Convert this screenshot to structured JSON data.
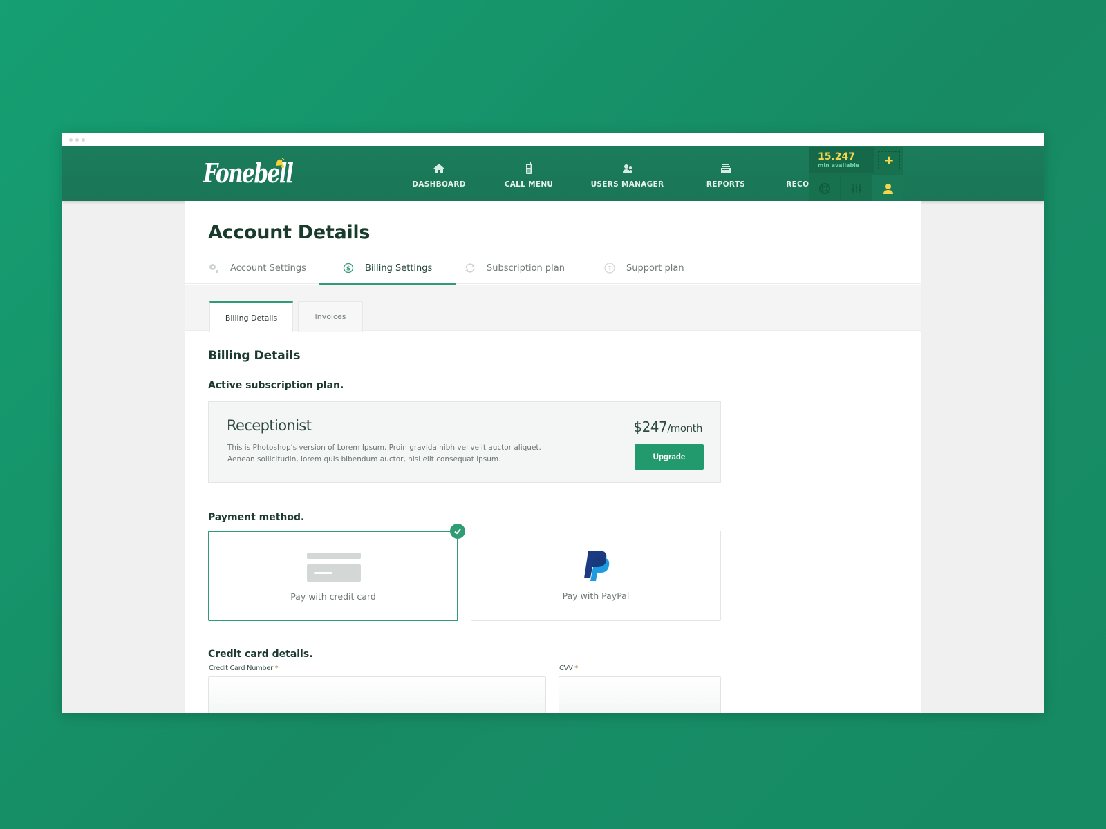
{
  "app": {
    "logo_text": "Fonebell",
    "colors": {
      "brand_green": "#1b7c5b",
      "accent_green": "#2f9c74",
      "button_green": "#239a6e",
      "minutes_yellow": "#f5d64a",
      "paypal_dark": "#1b3a82",
      "paypal_light": "#1e9ae0"
    }
  },
  "nav": {
    "items": [
      {
        "label": "DASHBOARD",
        "icon": "home-icon"
      },
      {
        "label": "CALL MENU",
        "icon": "mobile-phone-icon"
      },
      {
        "label": "USERS MANAGER",
        "icon": "users-icon"
      },
      {
        "label": "REPORTS",
        "icon": "reports-icon"
      },
      {
        "label": "RECORDINGS",
        "icon": "microphone-icon"
      }
    ],
    "minutes": {
      "value": "15.247",
      "caption": "min available",
      "add_label": "+"
    },
    "tools": [
      {
        "icon": "lifebuoy-icon"
      },
      {
        "icon": "sliders-icon"
      },
      {
        "icon": "user-icon"
      }
    ]
  },
  "page": {
    "title": "Account Details",
    "tabs": [
      {
        "label": "Account Settings",
        "icon": "gear-icon",
        "active": false
      },
      {
        "label": "Billing Settings",
        "icon": "dollar-circle-icon",
        "active": true
      },
      {
        "label": "Subscription plan",
        "icon": "refresh-icon",
        "active": false
      },
      {
        "label": "Support plan",
        "icon": "question-circle-icon",
        "active": false
      }
    ],
    "sub_tabs": [
      {
        "label": "Billing Details",
        "active": true
      },
      {
        "label": "Invoices",
        "active": false
      }
    ]
  },
  "billing": {
    "section_title": "Billing Details",
    "active_plan_label": "Active subscription plan.",
    "plan": {
      "name": "Receptionist",
      "description": "This is Photoshop's version  of Lorem Ipsum. Proin gravida nibh vel velit auctor aliquet. Aenean sollicitudin, lorem quis bibendum auctor, nisi elit consequat ipsum.",
      "price": "$247",
      "period": "/month",
      "upgrade_label": "Upgrade"
    },
    "payment_method_label": "Payment method.",
    "payment_options": [
      {
        "label": "Pay with credit card",
        "icon": "credit-card-icon",
        "selected": true
      },
      {
        "label": "Pay with PayPal",
        "icon": "paypal-icon",
        "selected": false
      }
    ],
    "card_details_label": "Credit card details.",
    "fields": {
      "card_number": {
        "label": "Credit Card Number",
        "required_mark": "*",
        "value": "",
        "placeholder": ""
      },
      "cvv": {
        "label": "CVV",
        "required_mark": "*",
        "value": "",
        "placeholder": ""
      }
    }
  }
}
